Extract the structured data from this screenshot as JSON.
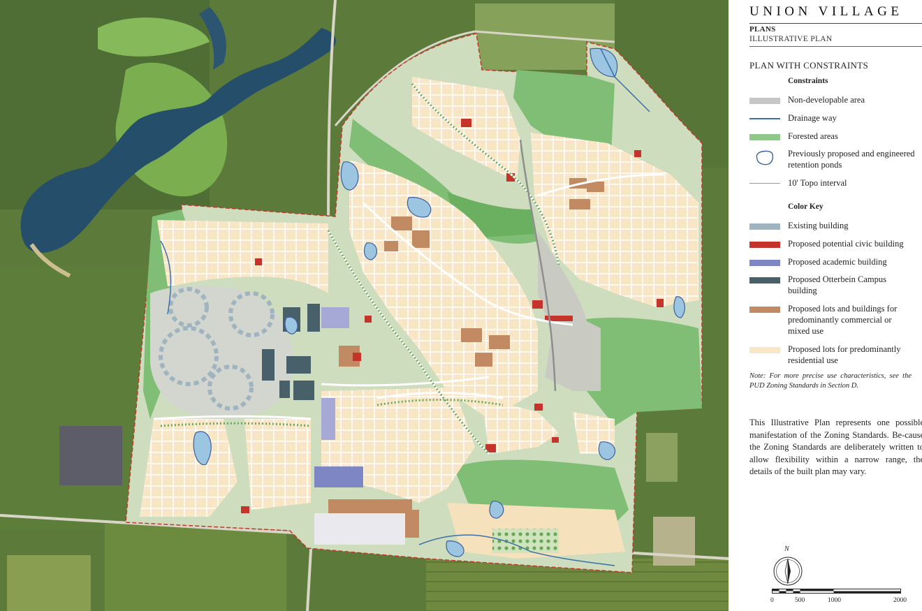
{
  "header": {
    "title": "UNION VILLAGE",
    "section": "PLANS",
    "subsection": "ILLUSTRATIVE PLAN",
    "plan_heading": "PLAN WITH CONSTRAINTS"
  },
  "legend": {
    "constraints_heading": "Constraints",
    "constraints": [
      {
        "label": "Non-developable area",
        "symbol": "swatch",
        "color": "#c6c6c6"
      },
      {
        "label": "Drainage way",
        "symbol": "line",
        "color": "#3c6fa8"
      },
      {
        "label": "Forested areas",
        "symbol": "swatch",
        "color": "#8fc88a"
      },
      {
        "label": "Previously proposed and engineered retention ponds",
        "symbol": "pond",
        "color": "#3c5f9a"
      },
      {
        "label": "10' Topo interval",
        "symbol": "thin-line",
        "color": "#9a9a9a"
      }
    ],
    "color_key_heading": "Color Key",
    "color_key": [
      {
        "label": "Existing building",
        "color": "#9fb4bf"
      },
      {
        "label": "Proposed potential civic building",
        "color": "#c4342b"
      },
      {
        "label": "Proposed academic building",
        "color": "#7f86c4"
      },
      {
        "label": "Proposed Otterbein Campus building",
        "color": "#48606a"
      },
      {
        "label": "Proposed lots and buildings for predominantly commercial or mixed use",
        "color": "#c28a62"
      },
      {
        "label": "Proposed lots for predominantly residential use",
        "color": "#f9e6c6"
      }
    ]
  },
  "note": "Note:  For more precise use characteristics, see the PUD Zoning Standards in Section D.",
  "description": "This Illustrative Plan represents one possible manifestation of the Zoning Standards.  Be-cause the Zoning Standards are deliberately written to allow flexibility within a narrow range, the details of the built plan may vary.",
  "north_label": "N",
  "scale_labels": [
    "0",
    "500",
    "1000",
    "2000"
  ]
}
